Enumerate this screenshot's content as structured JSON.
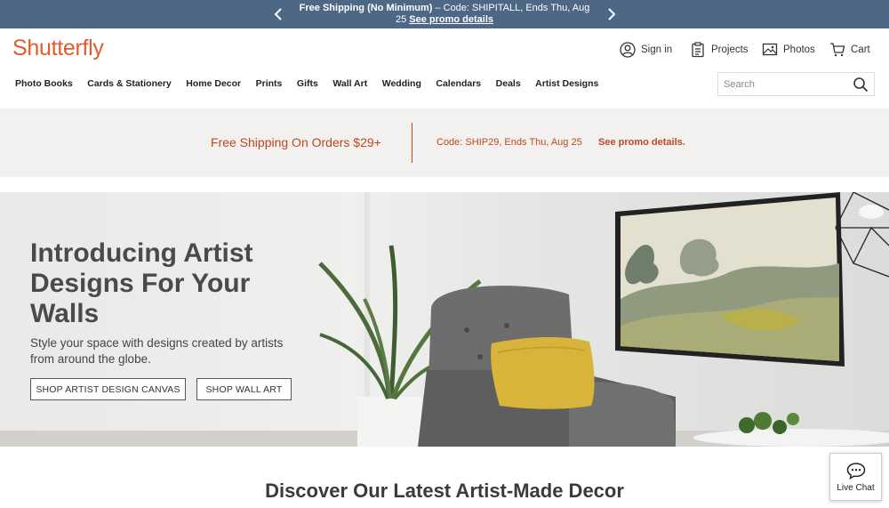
{
  "topbar": {
    "bold_text": "Free Shipping (No Minimum)",
    "text": " – Code: SHIPITALL, Ends Thu, Aug 25 ",
    "link": "See promo details"
  },
  "header": {
    "logo": "Shutterfly",
    "sign_in": "Sign in",
    "projects": "Projects",
    "photos": "Photos",
    "cart": "Cart"
  },
  "nav": {
    "items": [
      "Photo Books",
      "Cards & Stationery",
      "Home Decor",
      "Prints",
      "Gifts",
      "Wall Art",
      "Wedding",
      "Calendars",
      "Deals",
      "Artist Designs"
    ]
  },
  "search": {
    "placeholder": "Search"
  },
  "shipping_banner": {
    "headline": "Free Shipping On Orders $29+",
    "code": "Code: SHIP29, Ends Thu, Aug 25",
    "link": "See promo details."
  },
  "hero": {
    "title": "Introducing Artist Designs For Your Walls",
    "subtitle": "Style your space with designs created by artists from around the globe.",
    "button_canvas": "SHOP ARTIST DESIGN CANVAS",
    "button_wallart": "SHOP WALL ART"
  },
  "section": {
    "title": "Discover Our Latest Artist-Made Decor"
  },
  "livechat": {
    "label": "Live Chat"
  },
  "colors": {
    "topbar": "#4d6785",
    "brand": "#e25c2b",
    "promo": "#c0471d",
    "banner_bg": "#f2f1ef"
  },
  "icons": [
    "chevron-left-icon",
    "chevron-right-icon",
    "user-icon",
    "projects-icon",
    "photos-icon",
    "cart-icon",
    "search-icon",
    "chat-icon"
  ]
}
